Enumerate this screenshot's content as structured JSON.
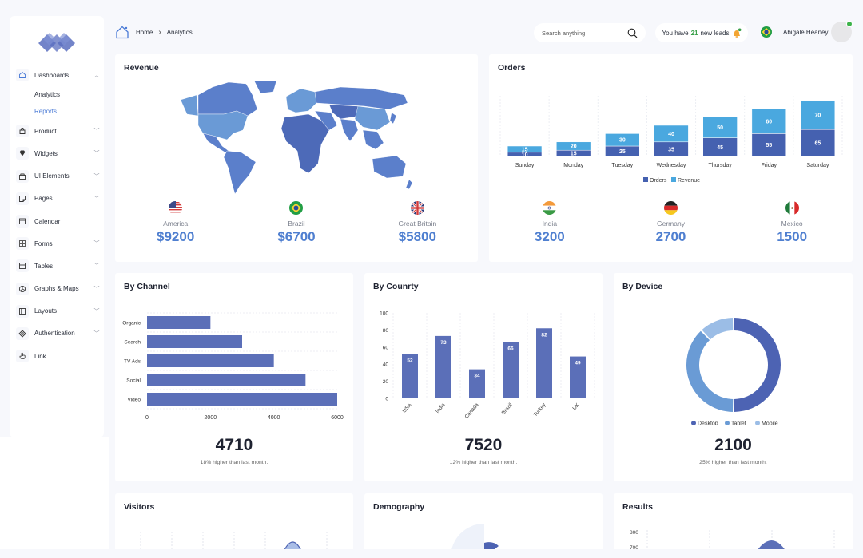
{
  "header": {
    "breadcrumb": [
      "Home",
      "Analytics"
    ],
    "search_placeholder": "Search anything",
    "leads_prefix": "You have",
    "leads_count": "21",
    "leads_suffix": "new leads",
    "user_name": "Abigale Heaney"
  },
  "sidebar": {
    "items": [
      {
        "label": "Dashboards",
        "icon": "home-icon",
        "expanded": true
      },
      {
        "label": "Product",
        "icon": "shopping-bag-icon"
      },
      {
        "label": "Widgets",
        "icon": "diamond-icon"
      },
      {
        "label": "UI Elements",
        "icon": "box-icon"
      },
      {
        "label": "Pages",
        "icon": "page-icon"
      },
      {
        "label": "Calendar",
        "icon": "calendar-icon"
      },
      {
        "label": "Forms",
        "icon": "grid-icon"
      },
      {
        "label": "Tables",
        "icon": "table-icon"
      },
      {
        "label": "Graphs & Maps",
        "icon": "pie-chart-icon"
      },
      {
        "label": "Layouts",
        "icon": "layout-icon"
      },
      {
        "label": "Authentication",
        "icon": "authentication-icon"
      },
      {
        "label": "Link",
        "icon": "hand-pointer-icon"
      }
    ],
    "subitems": [
      {
        "label": "Analytics",
        "active": false
      },
      {
        "label": "Reports",
        "active": true
      }
    ]
  },
  "revenue": {
    "title": "Revenue",
    "stats": [
      {
        "name": "America",
        "value": "$9200",
        "flag": "us"
      },
      {
        "name": "Brazil",
        "value": "$6700",
        "flag": "br"
      },
      {
        "name": "Great Britain",
        "value": "$5800",
        "flag": "gb"
      }
    ]
  },
  "orders": {
    "title": "Orders",
    "stats": [
      {
        "name": "India",
        "value": "3200",
        "flag": "in"
      },
      {
        "name": "Germany",
        "value": "2700",
        "flag": "de"
      },
      {
        "name": "Mexico",
        "value": "1500",
        "flag": "mx"
      }
    ]
  },
  "by_channel": {
    "title": "By Channel",
    "total": "4710",
    "note": "18% higher than last month."
  },
  "by_country": {
    "title": "By Counrty",
    "total": "7520",
    "note": "12% higher than last month."
  },
  "by_device": {
    "title": "By Device",
    "total": "2100",
    "note": "25% higher than last month."
  },
  "visitors": {
    "title": "Visitors"
  },
  "demography": {
    "title": "Demography"
  },
  "results": {
    "title": "Results",
    "y_ticks": [
      "800",
      "700"
    ]
  },
  "colors": {
    "primary": "#5b6fb8",
    "accent": "#4f7fd0",
    "orders": "#4561b0",
    "revenue": "#4aa8df",
    "green": "#3aa04a"
  },
  "chart_data": [
    {
      "id": "orders",
      "type": "bar",
      "stacked": true,
      "categories": [
        "Sunday",
        "Monday",
        "Tuesday",
        "Wednesday",
        "Thursday",
        "Friday",
        "Saturday"
      ],
      "series": [
        {
          "name": "Orders",
          "values": [
            10,
            15,
            25,
            35,
            45,
            55,
            65
          ],
          "color": "#4561b0"
        },
        {
          "name": "Revenue",
          "values": [
            15,
            20,
            30,
            40,
            50,
            60,
            70
          ],
          "color": "#4aa8df"
        }
      ],
      "legend": "bottom",
      "ylim": [
        0,
        140
      ]
    },
    {
      "id": "by_channel",
      "type": "bar",
      "orientation": "horizontal",
      "categories": [
        "Organic",
        "Search",
        "TV Ads",
        "Social",
        "Video"
      ],
      "values": [
        2000,
        3000,
        4000,
        5000,
        6000
      ],
      "xlim": [
        0,
        6000
      ],
      "xticks": [
        0,
        2000,
        4000,
        6000
      ],
      "grid": true
    },
    {
      "id": "by_country",
      "type": "bar",
      "categories": [
        "USA",
        "India",
        "Canada",
        "Brazil",
        "Turkey",
        "UK"
      ],
      "values": [
        52,
        73,
        34,
        66,
        82,
        49
      ],
      "ylim": [
        0,
        100
      ],
      "yticks": [
        0,
        20,
        40,
        60,
        80,
        100
      ],
      "data_labels": true,
      "grid": true
    },
    {
      "id": "by_device",
      "type": "pie",
      "donut": true,
      "labels": [
        "Desktop",
        "Tablet",
        "Mobile"
      ],
      "values": [
        50,
        38,
        12
      ],
      "colors": [
        "#4d63b3",
        "#6a9bd5",
        "#9bbde6"
      ],
      "legend": "bottom"
    }
  ]
}
